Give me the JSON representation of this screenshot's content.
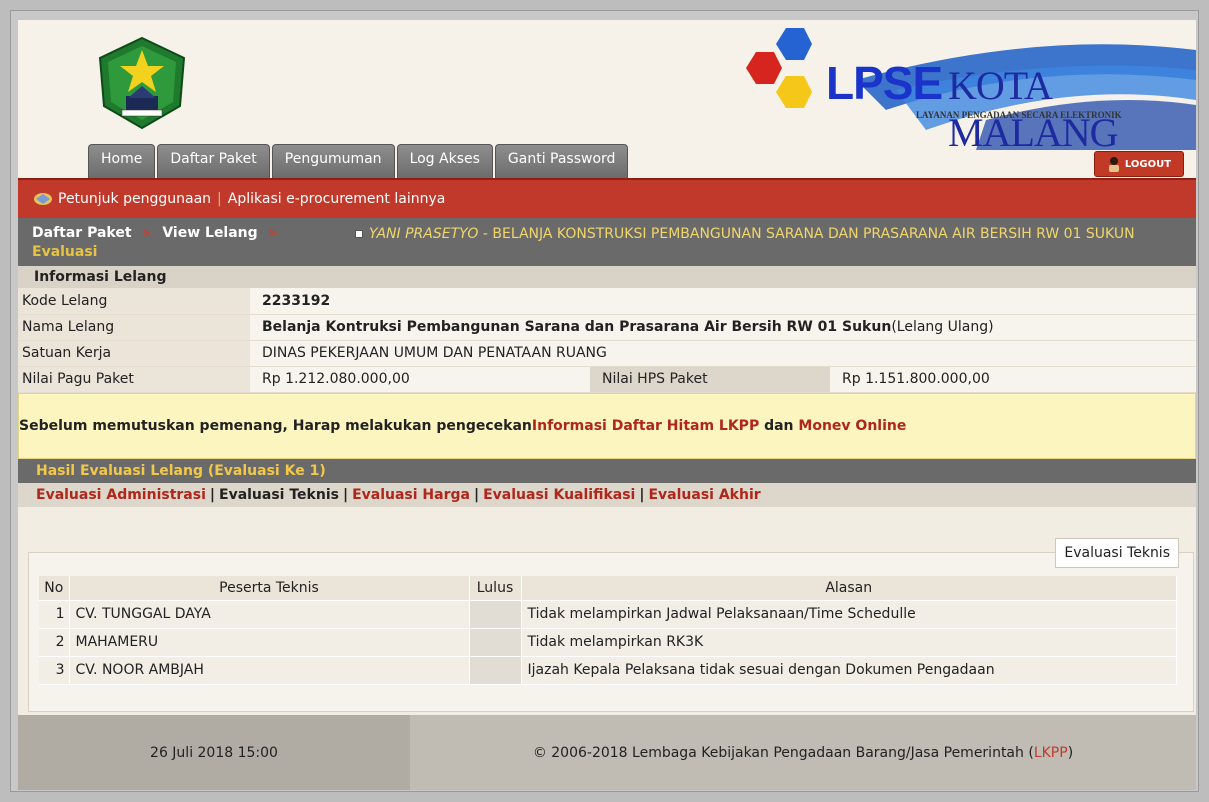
{
  "brand": {
    "lpse": "LPSE",
    "kota": "KOTA MALANG",
    "tagline": "LAYANAN PENGADAAN SECARA ELEKTRONIK",
    "colors": {
      "primary_red": "#c0392b",
      "nav_gray": "#6a6a6a",
      "accent_yellow": "#f2c84a"
    }
  },
  "tabs": [
    "Home",
    "Daftar Paket",
    "Pengumuman",
    "Log Akses",
    "Ganti Password"
  ],
  "logout_label": "LOGOUT",
  "toolbar": {
    "help_label": "Petunjuk penggunaan",
    "sep": "|",
    "apps_label": "Aplikasi e-procurement lainnya"
  },
  "breadcrumb": {
    "item1": "Daftar Paket",
    "item2": "View Lelang",
    "item3": "Evaluasi",
    "arrow": "»"
  },
  "marquee": {
    "user": "YANI PRASETYO",
    "text": " - BELANJA KONSTRUKSI PEMBANGUNAN SARANA DAN PRASARANA AIR BERSIH RW 01 SUKUN"
  },
  "info": {
    "heading": "Informasi Lelang",
    "kode_label": "Kode Lelang",
    "kode_value": "2233192",
    "nama_label": "Nama Lelang",
    "nama_value": "Belanja Kontruksi Pembangunan Sarana dan Prasarana Air Bersih RW 01 Sukun",
    "nama_suffix": "(Lelang Ulang)",
    "satker_label": "Satuan Kerja",
    "satker_value": "DINAS PEKERJAAN UMUM DAN PENATAAN RUANG",
    "pagu_label": "Nilai Pagu Paket",
    "pagu_value": "Rp 1.212.080.000,00",
    "hps_label": "Nilai HPS Paket",
    "hps_value": "Rp 1.151.800.000,00"
  },
  "notice": {
    "text": "Sebelum memutuskan pemenang, Harap melakukan pengecekan ",
    "link1": "Informasi Daftar Hitam LKPP",
    "and": " dan ",
    "link2": "Monev Online"
  },
  "evaluation": {
    "heading": "Hasil Evaluasi Lelang (Evaluasi Ke 1)",
    "links": [
      "Evaluasi Administrasi",
      "Evaluasi Teknis",
      "Evaluasi Harga",
      "Evaluasi Kualifikasi",
      "Evaluasi Akhir"
    ],
    "active": "Evaluasi Teknis",
    "panel_tab": "Evaluasi Teknis",
    "columns": {
      "no": "No",
      "peserta": "Peserta Teknis",
      "lulus": "Lulus",
      "alasan": "Alasan"
    },
    "rows": [
      {
        "no": "1",
        "peserta": "CV. TUNGGAL DAYA",
        "lulus": "",
        "alasan": "Tidak melampirkan Jadwal Pelaksanaan/Time Schedulle"
      },
      {
        "no": "2",
        "peserta": "MAHAMERU",
        "lulus": "",
        "alasan": "Tidak melampirkan RK3K"
      },
      {
        "no": "3",
        "peserta": "CV. NOOR AMBJAH",
        "lulus": "",
        "alasan": "Ijazah Kepala Pelaksana tidak sesuai dengan Dokumen Pengadaan"
      }
    ]
  },
  "footer": {
    "datetime": "26 Juli 2018 15:00",
    "copyright": "© 2006-2018 Lembaga Kebijakan Pengadaan Barang/Jasa Pemerintah (",
    "lkpp": "LKPP",
    "close": ")"
  }
}
